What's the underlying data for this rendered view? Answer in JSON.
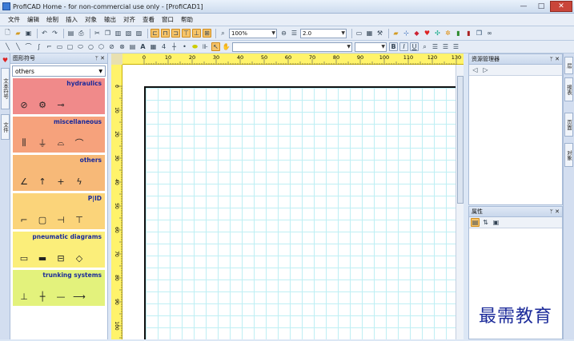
{
  "window": {
    "title": "ProfiCAD Home - for non-commercial use only - [ProfiCAD1]",
    "min": "—",
    "max": "□",
    "close": "✕"
  },
  "menu": [
    "文件",
    "编辑",
    "绘制",
    "插入",
    "对象",
    "输出",
    "对齐",
    "查看",
    "窗口",
    "帮助"
  ],
  "toolbar": {
    "zoom_value": "100%",
    "line_width_value": "2.0",
    "font_value": "",
    "bold_label": "B",
    "italic_label": "I",
    "underline_label": "U",
    "text_tool_label": "A",
    "number_tool_label": "4"
  },
  "left_strip": {
    "tabs": [
      "文本符号",
      "文件"
    ]
  },
  "symbols_panel": {
    "title": "图形符号",
    "pin": "ᛘ",
    "close": "✕",
    "library_value": "others",
    "categories": [
      {
        "name": "hydraulics",
        "color": "#f08a8a",
        "symbols": [
          "⊘",
          "⚙",
          "⊸"
        ]
      },
      {
        "name": "miscellaneous",
        "color": "#f6a27c",
        "symbols": [
          "⫼",
          "⏚",
          "⌓",
          "⌒"
        ]
      },
      {
        "name": "others",
        "color": "#f7b978",
        "symbols": [
          "∠",
          "↑",
          "+",
          "ϟ"
        ]
      },
      {
        "name": "P|ID",
        "color": "#fbd47a",
        "symbols": [
          "⌐",
          "▢",
          "⊣",
          "⊤"
        ]
      },
      {
        "name": "pneumatic diagrams",
        "color": "#fbee7a",
        "symbols": [
          "▭",
          "▬",
          "⊟",
          "◇"
        ]
      },
      {
        "name": "trunking systems",
        "color": "#e3f27c",
        "symbols": [
          "⊥",
          "┼",
          "—",
          "⟶"
        ]
      }
    ]
  },
  "ruler": {
    "h_ticks": [
      "0",
      "10",
      "20",
      "30",
      "40",
      "50",
      "60",
      "70",
      "80",
      "90",
      "100",
      "110",
      "120",
      "130"
    ],
    "v_ticks": [
      "0",
      "10",
      "20",
      "30",
      "40",
      "50",
      "60",
      "70",
      "80",
      "90",
      "100"
    ]
  },
  "explorer_panel": {
    "title": "资源管理器",
    "pin": "ᛘ",
    "close": "✕",
    "back": "◁",
    "forward": "▷"
  },
  "properties_panel": {
    "title": "属性",
    "pin": "ᛘ",
    "close": "✕"
  },
  "right_strip": {
    "tabs": [
      "层",
      "报表",
      "页面",
      "对象"
    ]
  },
  "watermark": "最需教育"
}
